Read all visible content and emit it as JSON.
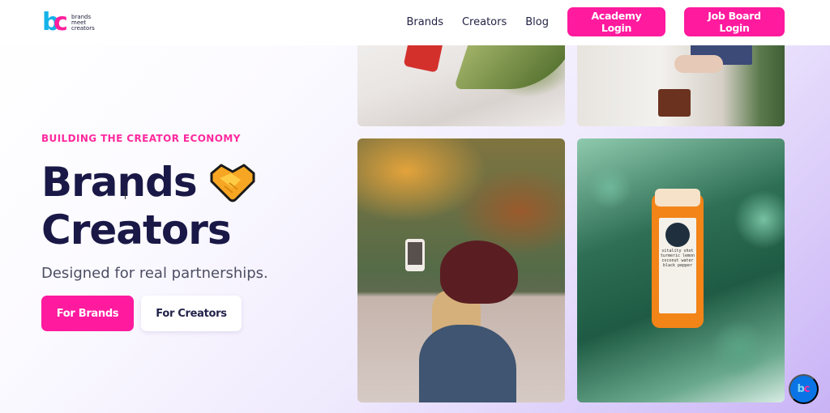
{
  "header": {
    "logo": {
      "mark_b": "b",
      "mark_c": "c",
      "lines": [
        "brands",
        "meet",
        "creators"
      ]
    },
    "nav": [
      {
        "label": "Brands"
      },
      {
        "label": "Creators"
      },
      {
        "label": "Blog"
      }
    ],
    "buttons": {
      "academy_login": "Academy Login",
      "job_board_login": "Job Board Login"
    }
  },
  "hero": {
    "eyebrow": "BUILDING THE CREATOR ECONOMY",
    "title_line1": "Brands",
    "title_line2": "Creators",
    "title_emoji": "handshake-icon",
    "subtitle": "Designed for real partnerships.",
    "cta": {
      "brands": "For Brands",
      "creators": "For Creators"
    }
  },
  "gallery": [
    {
      "alt": "red skincare bottle on white fabric with leaves"
    },
    {
      "alt": "person holding palette box"
    },
    {
      "alt": "woman in beanie taking selfie in autumn forest"
    },
    {
      "alt": "orange juice bottle on green leaves",
      "label_text": "vitality shot turmeric lemon coconut water black pepper"
    }
  ],
  "chat": {
    "mark_b": "b",
    "mark_c": "c"
  },
  "colors": {
    "accent": "#ff1a9e",
    "heading": "#191846",
    "chat": "#0a74e6"
  }
}
